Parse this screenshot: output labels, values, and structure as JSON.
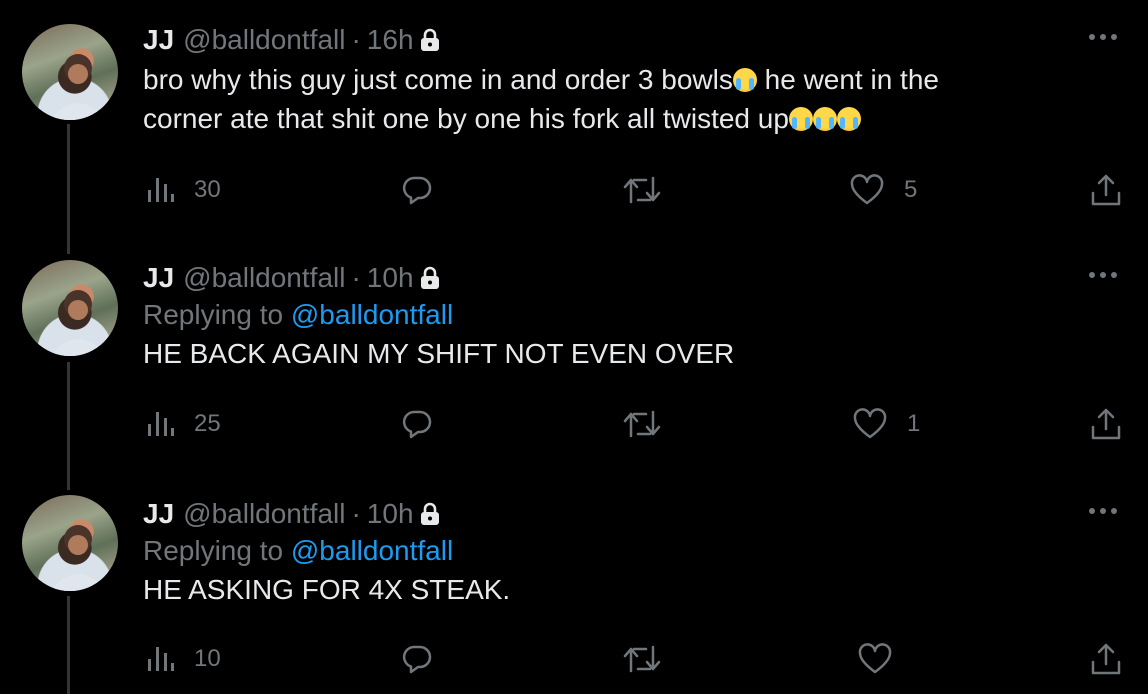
{
  "tweets": [
    {
      "name": "JJ",
      "handle": "@balldontfall",
      "separator": "·",
      "time": "16h",
      "reply_prefix": "",
      "reply_mention": "",
      "text_line1": "bro why this guy just come in and order 3 bowls",
      "text_line1_after": " he went in the",
      "text_line2": "corner ate that shit one by one his fork all twisted up",
      "views": "30",
      "likes": "5"
    },
    {
      "name": "JJ",
      "handle": "@balldontfall",
      "separator": "·",
      "time": "10h",
      "reply_prefix": "Replying to ",
      "reply_mention": "@balldontfall",
      "text": "HE BACK AGAIN MY SHIFT NOT EVEN OVER",
      "views": "25",
      "likes": "1"
    },
    {
      "name": "JJ",
      "handle": "@balldontfall",
      "separator": "·",
      "time": "10h",
      "reply_prefix": "Replying to ",
      "reply_mention": "@balldontfall",
      "text": "HE ASKING FOR 4X STEAK.",
      "views": "10",
      "likes": ""
    }
  ],
  "icons": {
    "lock": "lock-icon",
    "more": "more-icon",
    "views": "views-icon",
    "reply": "reply-icon",
    "retweet": "retweet-icon",
    "like": "heart-icon",
    "share": "share-icon",
    "emoji": "loudly-crying-face-emoji"
  },
  "colors": {
    "background": "#000000",
    "text": "#e7e9ea",
    "secondary": "#71767b",
    "link": "#1d9bf0",
    "thread_line": "#333639"
  }
}
